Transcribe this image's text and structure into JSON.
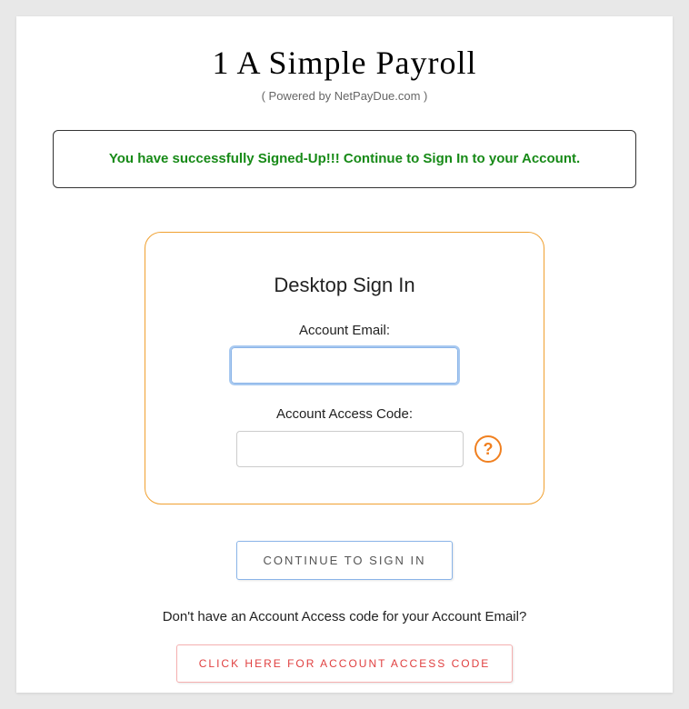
{
  "header": {
    "title": "1 A Simple Payroll",
    "subtitle": "( Powered by NetPayDue.com )"
  },
  "banner": {
    "message": "You have successfully Signed-Up!!! Continue to Sign In to your Account."
  },
  "signin": {
    "title": "Desktop Sign In",
    "email_label": "Account Email:",
    "email_value": "",
    "code_label": "Account Access Code:",
    "code_value": "",
    "help_symbol": "?"
  },
  "actions": {
    "continue_label": "CONTINUE TO SIGN IN",
    "helper_text": "Don't have an Account Access code for your Account Email?",
    "get_code_label": "CLICK HERE FOR ACCOUNT ACCESS CODE"
  }
}
